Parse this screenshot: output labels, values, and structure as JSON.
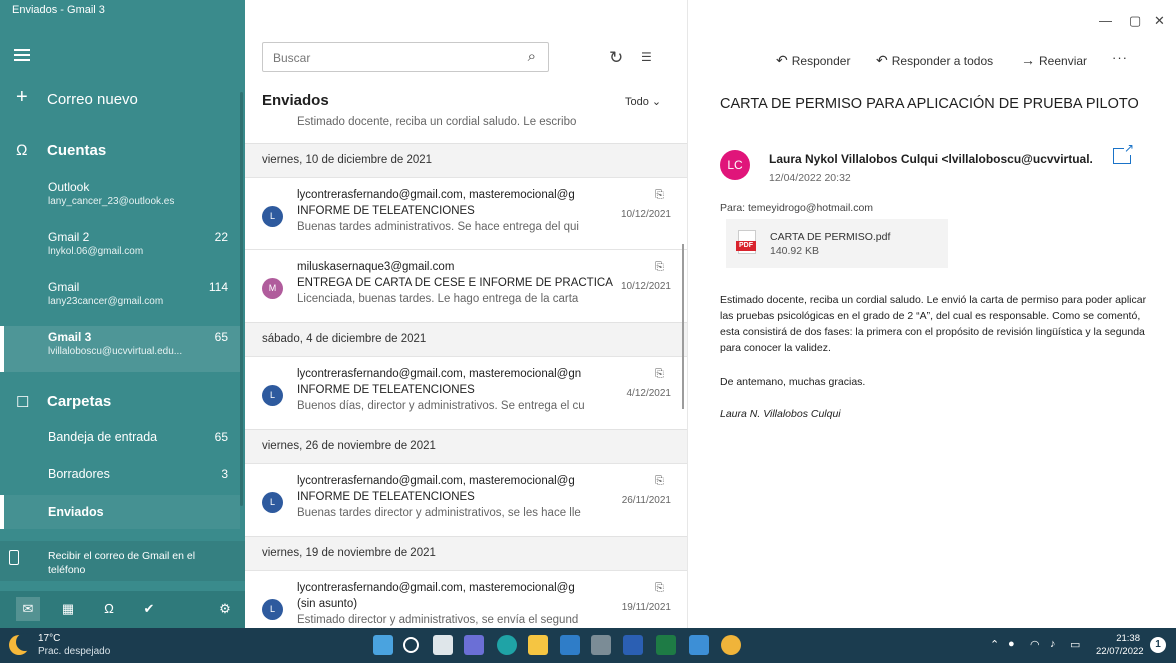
{
  "window": {
    "title": "Enviados - Gmail 3",
    "controls": {
      "minimize": "—",
      "maximize": "▢",
      "close": "✕"
    }
  },
  "sidebar": {
    "new_mail": "Correo nuevo",
    "accounts_heading": "Cuentas",
    "accounts": [
      {
        "name": "Outlook",
        "address": "lany_cancer_23@outlook.es",
        "count": ""
      },
      {
        "name": "Gmail 2",
        "address": "lnykol.06@gmail.com",
        "count": "22"
      },
      {
        "name": "Gmail",
        "address": "lany23cancer@gmail.com",
        "count": "114"
      },
      {
        "name": "Gmail 3",
        "address": "lvillaloboscu@ucvvirtual.edu...",
        "count": "65"
      }
    ],
    "folders_heading": "Carpetas",
    "folders": [
      {
        "name": "Bandeja de entrada",
        "count": "65"
      },
      {
        "name": "Borradores",
        "count": "3"
      },
      {
        "name": "Enviados",
        "count": ""
      }
    ],
    "promo": "Recibir el correo de Gmail en el teléfono",
    "bottom_icons": [
      "mail-icon",
      "calendar-icon",
      "people-icon",
      "todo-icon",
      "settings-icon"
    ]
  },
  "list": {
    "search_placeholder": "Buscar",
    "title": "Enviados",
    "filter": "Todo",
    "partial_preview": "Estimado docente, reciba un cordial saludo. Le escribo",
    "groups": [
      {
        "date": "viernes, 10 de diciembre de 2021",
        "items": [
          {
            "initial": "L",
            "from": "lycontrerasfernando@gmail.com, masteremocional@g",
            "subject": "INFORME DE TELEATENCIONES",
            "preview": "Buenas tardes administrativos. Se hace entrega del qui",
            "date": "10/12/2021"
          },
          {
            "initial": "M",
            "from": "miluskasernaque3@gmail.com",
            "subject": "ENTREGA DE CARTA DE CESE E INFORME DE PRÁCTICA",
            "preview": "Licenciada, buenas tardes. Le hago entrega de la carta",
            "date": "10/12/2021"
          }
        ]
      },
      {
        "date": "sábado, 4 de diciembre de 2021",
        "items": [
          {
            "initial": "L",
            "from": "lycontrerasfernando@gmail.com, masteremocional@gn",
            "subject": "INFORME DE TELEATENCIONES",
            "preview": "Buenos días, director y administrativos. Se entrega el cu",
            "date": "4/12/2021"
          }
        ]
      },
      {
        "date": "viernes, 26 de noviembre de 2021",
        "items": [
          {
            "initial": "L",
            "from": "lycontrerasfernando@gmail.com, masteremocional@g",
            "subject": "INFORME DE TELEATENCIONES",
            "preview": "Buenas tardes director y administrativos, se les hace lle",
            "date": "26/11/2021"
          }
        ]
      },
      {
        "date": "viernes, 19 de noviembre de 2021",
        "items": [
          {
            "initial": "L",
            "from": "lycontrerasfernando@gmail.com, masteremocional@g",
            "subject": "(sin asunto)",
            "preview": "Estimado director y administrativos, se envía el segund",
            "date": "19/11/2021"
          }
        ]
      }
    ]
  },
  "reader": {
    "actions": {
      "reply": "Responder",
      "reply_all": "Responder a todos",
      "forward": "Reenviar",
      "more": "···"
    },
    "subject": "CARTA DE PERMISO PARA APLICACIÓN DE PRUEBA PILOTO",
    "sender_initials": "LC",
    "sender": "Laura Nykol Villalobos Culqui <lvillaloboscu@ucvvirtual.",
    "sent_date": "12/04/2022 20:32",
    "to": "Para: temeyidrogo@hotmail.com",
    "attachment": {
      "name": "CARTA DE PERMISO.pdf",
      "size": "140.92 KB",
      "type": "PDF"
    },
    "body": [
      "Estimado docente, reciba un cordial saludo. Le envió la carta de permiso para poder aplicar las pruebas psicológicas en el grado de 2 “A”, del cual es responsable. Como se comentó, esta consistirá de dos fases: la primera con el propósito de revisión lingüística  y la segunda para conocer la validez.",
      "De antemano, muchas gracias.",
      "Laura N. Villalobos Culqui"
    ]
  },
  "taskbar": {
    "temperature": "17°C",
    "weather": "Prac. despejado",
    "time": "21:38",
    "date": "22/07/2022",
    "notifications": "1",
    "colors": {
      "background": "#1b3c4f",
      "sidebar": "#3a8b8c",
      "accent": "#1a73c8"
    }
  }
}
